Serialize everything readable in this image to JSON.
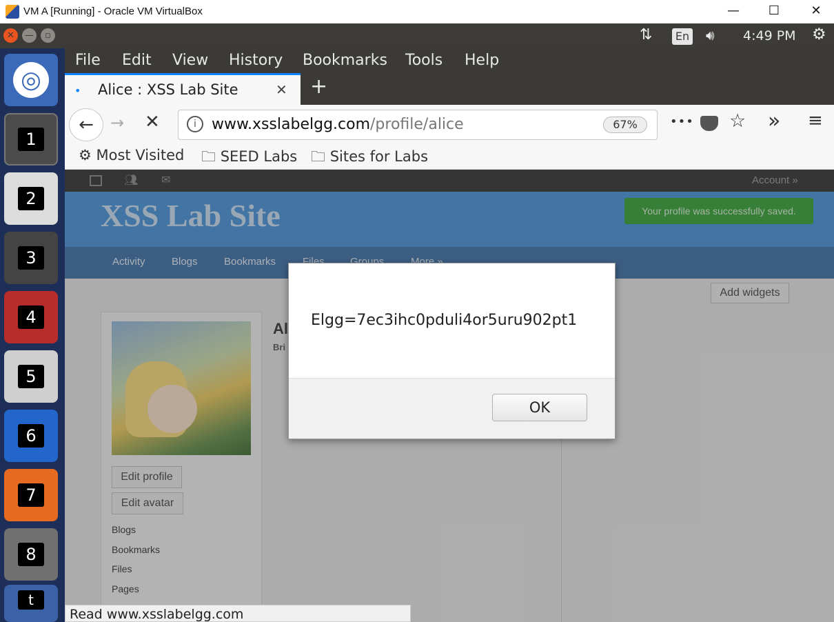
{
  "window": {
    "title": "VM A [Running] - Oracle VM VirtualBox",
    "minimize": "—",
    "maximize": "☐",
    "close": "✕"
  },
  "ubuntu": {
    "time": "4:49 PM",
    "lang": "En"
  },
  "launcher": {
    "items": [
      "1",
      "2",
      "3",
      "4",
      "5",
      "6",
      "7",
      "8",
      "t"
    ]
  },
  "menu": {
    "file": "File",
    "edit": "Edit",
    "view": "View",
    "history": "History",
    "bookmarks": "Bookmarks",
    "tools": "Tools",
    "help": "Help"
  },
  "tab": {
    "title": "Alice : XSS Lab Site",
    "close": "✕",
    "new": "+"
  },
  "nav": {
    "url_domain": "www.xsslabelgg.com",
    "url_path": "/profile/alice",
    "zoom": "67%",
    "more": "•••",
    "overflow": "»",
    "menu": "≡"
  },
  "bookmarks_bar": {
    "most_visited": "Most Visited",
    "seed_labs": "SEED Labs",
    "sites_for_labs": "Sites for Labs"
  },
  "site": {
    "account": "Account »",
    "title": "XSS Lab Site",
    "notice": "Your profile was successfully saved.",
    "nav": [
      "Activity",
      "Blogs",
      "Bookmarks",
      "Files",
      "Groups",
      "More »"
    ],
    "add_widgets": "Add widgets",
    "profile_name": "Al",
    "profile_sub": "Bri",
    "edit_profile": "Edit profile",
    "edit_avatar": "Edit avatar",
    "links": [
      "Blogs",
      "Bookmarks",
      "Files",
      "Pages"
    ]
  },
  "dialog": {
    "message": "Elgg=7ec3ihc0pduli4or5uru902pt1",
    "ok": "OK"
  },
  "status": {
    "text": "Read www.xsslabelgg.com"
  }
}
